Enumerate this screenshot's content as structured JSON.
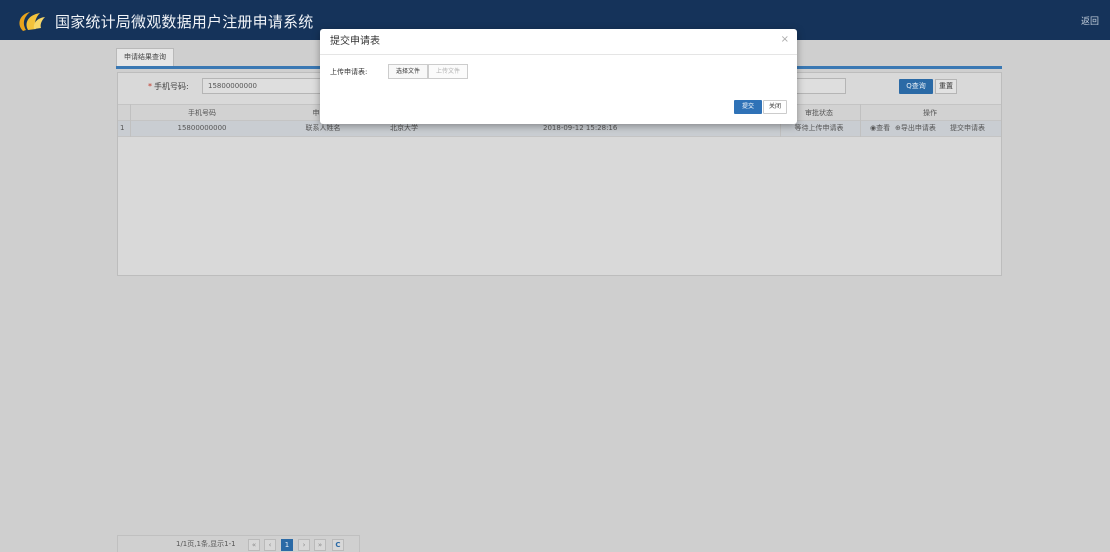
{
  "header": {
    "title": "国家统计局微观数据用户注册申请系统",
    "back_label": "返回"
  },
  "tabs": [
    {
      "label": "申请结果查询"
    }
  ],
  "search": {
    "phone_label": "手机号码:",
    "required_mark": "*",
    "phone_value": "15800000000",
    "query_label": "Q查询",
    "reset_label": "重置"
  },
  "table": {
    "columns": [
      "手机号码",
      "申",
      "审批状态",
      "操作"
    ],
    "rows": [
      {
        "index": "1",
        "phone": "15800000000",
        "contact": "联系人姓名",
        "org": "北京大学",
        "time": "2018-09-12 15:28:16",
        "status": "等待上传申请表",
        "action_view": "◉查看",
        "action_export": "⊕导出申请表",
        "action_submit": "提交申请表"
      }
    ]
  },
  "pagination": {
    "info": "1/1页,1条,显示1-1",
    "first": "«",
    "prev": "‹",
    "current": "1",
    "next": "›",
    "last": "»",
    "refresh": "C"
  },
  "modal": {
    "title": "提交申请表",
    "close_symbol": "×",
    "upload_label": "上传申请表:",
    "choose_file_label": "选择文件",
    "upload_file_label": "上传文件",
    "submit_label": "提交",
    "close_label": "关闭"
  },
  "colors": {
    "header_bg": "#15335a",
    "accent": "#2b6aa6"
  }
}
